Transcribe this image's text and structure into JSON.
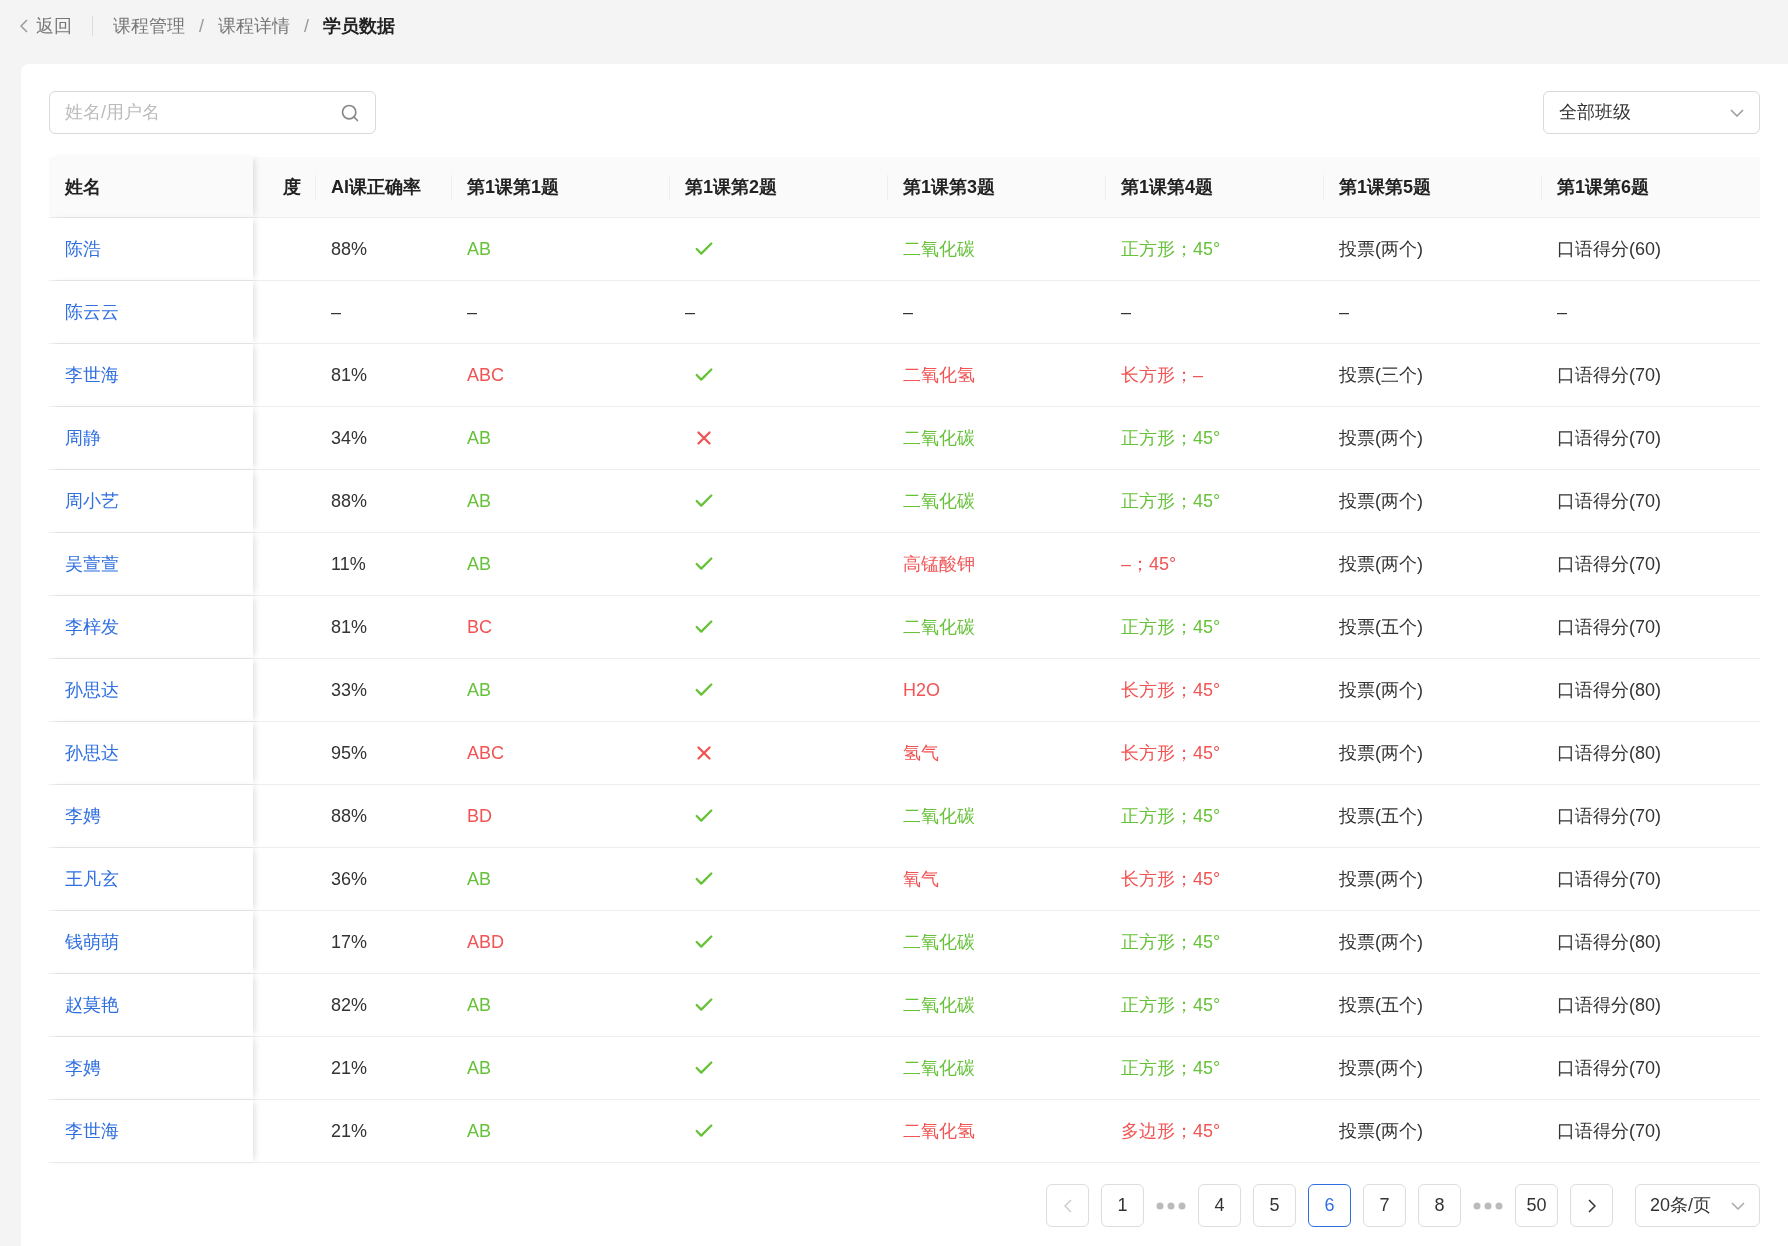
{
  "breadcrumb": {
    "back": "返回",
    "items": [
      {
        "kind": "link",
        "label": "课程管理",
        "current": false
      },
      {
        "kind": "separator",
        "label": "/"
      },
      {
        "kind": "link",
        "label": "课程详情",
        "current": false
      },
      {
        "kind": "separator",
        "label": "/"
      },
      {
        "kind": "link",
        "label": "学员数据",
        "current": true
      }
    ]
  },
  "search": {
    "placeholder": "姓名/用户名"
  },
  "class_filter": {
    "value": "全部班级"
  },
  "table": {
    "columns": [
      "姓名",
      "度",
      "AI课正确率",
      "第1课第1题",
      "第1课第2题",
      "第1课第3题",
      "第1课第4题",
      "第1课第5题",
      "第1课第6题"
    ],
    "rows": [
      {
        "cells": [
          {
            "kind": "link",
            "text": "陈浩"
          },
          {
            "kind": "plain",
            "text": ""
          },
          {
            "kind": "plain",
            "text": "88%"
          },
          {
            "kind": "answer",
            "text": "AB",
            "graded": true,
            "correct": true
          },
          {
            "kind": "icon",
            "graded": true,
            "correct": true
          },
          {
            "kind": "answer",
            "text": "二氧化碳",
            "graded": true,
            "correct": true
          },
          {
            "kind": "answer",
            "text": "正方形；45°",
            "graded": true,
            "correct": true
          },
          {
            "kind": "answer",
            "text": "投票(两个)",
            "graded": false
          },
          {
            "kind": "answer",
            "text": "口语得分(60)",
            "graded": false
          }
        ]
      },
      {
        "cells": [
          {
            "kind": "link",
            "text": "陈云云"
          },
          {
            "kind": "plain",
            "text": ""
          },
          {
            "kind": "plain",
            "text": "–"
          },
          {
            "kind": "answer",
            "text": "–",
            "graded": false
          },
          {
            "kind": "answer",
            "text": "–",
            "graded": false
          },
          {
            "kind": "answer",
            "text": "–",
            "graded": false
          },
          {
            "kind": "answer",
            "text": "–",
            "graded": false
          },
          {
            "kind": "answer",
            "text": "–",
            "graded": false
          },
          {
            "kind": "answer",
            "text": "–",
            "graded": false
          }
        ]
      },
      {
        "cells": [
          {
            "kind": "link",
            "text": "李世海"
          },
          {
            "kind": "plain",
            "text": ""
          },
          {
            "kind": "plain",
            "text": "81%"
          },
          {
            "kind": "answer",
            "text": "ABC",
            "graded": true,
            "correct": false
          },
          {
            "kind": "icon",
            "graded": true,
            "correct": true
          },
          {
            "kind": "answer",
            "text": "二氧化氢",
            "graded": true,
            "correct": false
          },
          {
            "kind": "answer",
            "text": "长方形；–",
            "graded": true,
            "correct": false
          },
          {
            "kind": "answer",
            "text": "投票(三个)",
            "graded": false
          },
          {
            "kind": "answer",
            "text": "口语得分(70)",
            "graded": false
          }
        ]
      },
      {
        "cells": [
          {
            "kind": "link",
            "text": "周静"
          },
          {
            "kind": "plain",
            "text": ""
          },
          {
            "kind": "plain",
            "text": "34%"
          },
          {
            "kind": "answer",
            "text": "AB",
            "graded": true,
            "correct": true
          },
          {
            "kind": "icon",
            "graded": true,
            "correct": false
          },
          {
            "kind": "answer",
            "text": "二氧化碳",
            "graded": true,
            "correct": true
          },
          {
            "kind": "answer",
            "text": "正方形；45°",
            "graded": true,
            "correct": true
          },
          {
            "kind": "answer",
            "text": "投票(两个)",
            "graded": false
          },
          {
            "kind": "answer",
            "text": "口语得分(70)",
            "graded": false
          }
        ]
      },
      {
        "cells": [
          {
            "kind": "link",
            "text": "周小艺"
          },
          {
            "kind": "plain",
            "text": ""
          },
          {
            "kind": "plain",
            "text": "88%"
          },
          {
            "kind": "answer",
            "text": "AB",
            "graded": true,
            "correct": true
          },
          {
            "kind": "icon",
            "graded": true,
            "correct": true
          },
          {
            "kind": "answer",
            "text": "二氧化碳",
            "graded": true,
            "correct": true
          },
          {
            "kind": "answer",
            "text": "正方形；45°",
            "graded": true,
            "correct": true
          },
          {
            "kind": "answer",
            "text": "投票(两个)",
            "graded": false
          },
          {
            "kind": "answer",
            "text": "口语得分(70)",
            "graded": false
          }
        ]
      },
      {
        "cells": [
          {
            "kind": "link",
            "text": "吴萱萱"
          },
          {
            "kind": "plain",
            "text": ""
          },
          {
            "kind": "plain",
            "text": "11%"
          },
          {
            "kind": "answer",
            "text": "AB",
            "graded": true,
            "correct": true
          },
          {
            "kind": "icon",
            "graded": true,
            "correct": true
          },
          {
            "kind": "answer",
            "text": "高锰酸钾",
            "graded": true,
            "correct": false
          },
          {
            "kind": "answer",
            "text": "–；45°",
            "graded": true,
            "correct": false
          },
          {
            "kind": "answer",
            "text": "投票(两个)",
            "graded": false
          },
          {
            "kind": "answer",
            "text": "口语得分(70)",
            "graded": false
          }
        ]
      },
      {
        "cells": [
          {
            "kind": "link",
            "text": "李梓发"
          },
          {
            "kind": "plain",
            "text": ""
          },
          {
            "kind": "plain",
            "text": "81%"
          },
          {
            "kind": "answer",
            "text": "BC",
            "graded": true,
            "correct": false
          },
          {
            "kind": "icon",
            "graded": true,
            "correct": true
          },
          {
            "kind": "answer",
            "text": "二氧化碳",
            "graded": true,
            "correct": true
          },
          {
            "kind": "answer",
            "text": "正方形；45°",
            "graded": true,
            "correct": true
          },
          {
            "kind": "answer",
            "text": "投票(五个)",
            "graded": false
          },
          {
            "kind": "answer",
            "text": "口语得分(70)",
            "graded": false
          }
        ]
      },
      {
        "cells": [
          {
            "kind": "link",
            "text": "孙思达"
          },
          {
            "kind": "plain",
            "text": ""
          },
          {
            "kind": "plain",
            "text": "33%"
          },
          {
            "kind": "answer",
            "text": "AB",
            "graded": true,
            "correct": true
          },
          {
            "kind": "icon",
            "graded": true,
            "correct": true
          },
          {
            "kind": "answer",
            "text": "H2O",
            "graded": true,
            "correct": false
          },
          {
            "kind": "answer",
            "text": "长方形；45°",
            "graded": true,
            "correct": false
          },
          {
            "kind": "answer",
            "text": "投票(两个)",
            "graded": false
          },
          {
            "kind": "answer",
            "text": "口语得分(80)",
            "graded": false
          }
        ]
      },
      {
        "cells": [
          {
            "kind": "link",
            "text": "孙思达"
          },
          {
            "kind": "plain",
            "text": ""
          },
          {
            "kind": "plain",
            "text": "95%"
          },
          {
            "kind": "answer",
            "text": "ABC",
            "graded": true,
            "correct": false
          },
          {
            "kind": "icon",
            "graded": true,
            "correct": false
          },
          {
            "kind": "answer",
            "text": "氢气",
            "graded": true,
            "correct": false
          },
          {
            "kind": "answer",
            "text": "长方形；45°",
            "graded": true,
            "correct": false
          },
          {
            "kind": "answer",
            "text": "投票(两个)",
            "graded": false
          },
          {
            "kind": "answer",
            "text": "口语得分(80)",
            "graded": false
          }
        ]
      },
      {
        "cells": [
          {
            "kind": "link",
            "text": "李娉"
          },
          {
            "kind": "plain",
            "text": ""
          },
          {
            "kind": "plain",
            "text": "88%"
          },
          {
            "kind": "answer",
            "text": "BD",
            "graded": true,
            "correct": false
          },
          {
            "kind": "icon",
            "graded": true,
            "correct": true
          },
          {
            "kind": "answer",
            "text": "二氧化碳",
            "graded": true,
            "correct": true
          },
          {
            "kind": "answer",
            "text": "正方形；45°",
            "graded": true,
            "correct": true
          },
          {
            "kind": "answer",
            "text": "投票(五个)",
            "graded": false
          },
          {
            "kind": "answer",
            "text": "口语得分(70)",
            "graded": false
          }
        ]
      },
      {
        "cells": [
          {
            "kind": "link",
            "text": "王凡玄"
          },
          {
            "kind": "plain",
            "text": ""
          },
          {
            "kind": "plain",
            "text": "36%"
          },
          {
            "kind": "answer",
            "text": "AB",
            "graded": true,
            "correct": true
          },
          {
            "kind": "icon",
            "graded": true,
            "correct": true
          },
          {
            "kind": "answer",
            "text": "氧气",
            "graded": true,
            "correct": false
          },
          {
            "kind": "answer",
            "text": "长方形；45°",
            "graded": true,
            "correct": false
          },
          {
            "kind": "answer",
            "text": "投票(两个)",
            "graded": false
          },
          {
            "kind": "answer",
            "text": "口语得分(70)",
            "graded": false
          }
        ]
      },
      {
        "cells": [
          {
            "kind": "link",
            "text": "钱萌萌"
          },
          {
            "kind": "plain",
            "text": ""
          },
          {
            "kind": "plain",
            "text": "17%"
          },
          {
            "kind": "answer",
            "text": "ABD",
            "graded": true,
            "correct": false
          },
          {
            "kind": "icon",
            "graded": true,
            "correct": true
          },
          {
            "kind": "answer",
            "text": "二氧化碳",
            "graded": true,
            "correct": true
          },
          {
            "kind": "answer",
            "text": "正方形；45°",
            "graded": true,
            "correct": true
          },
          {
            "kind": "answer",
            "text": "投票(两个)",
            "graded": false
          },
          {
            "kind": "answer",
            "text": "口语得分(80)",
            "graded": false
          }
        ]
      },
      {
        "cells": [
          {
            "kind": "link",
            "text": "赵莫艳"
          },
          {
            "kind": "plain",
            "text": ""
          },
          {
            "kind": "plain",
            "text": "82%"
          },
          {
            "kind": "answer",
            "text": "AB",
            "graded": true,
            "correct": true
          },
          {
            "kind": "icon",
            "graded": true,
            "correct": true
          },
          {
            "kind": "answer",
            "text": "二氧化碳",
            "graded": true,
            "correct": true
          },
          {
            "kind": "answer",
            "text": "正方形；45°",
            "graded": true,
            "correct": true
          },
          {
            "kind": "answer",
            "text": "投票(五个)",
            "graded": false
          },
          {
            "kind": "answer",
            "text": "口语得分(80)",
            "graded": false
          }
        ]
      },
      {
        "cells": [
          {
            "kind": "link",
            "text": "李娉"
          },
          {
            "kind": "plain",
            "text": ""
          },
          {
            "kind": "plain",
            "text": "21%"
          },
          {
            "kind": "answer",
            "text": "AB",
            "graded": true,
            "correct": true
          },
          {
            "kind": "icon",
            "graded": true,
            "correct": true
          },
          {
            "kind": "answer",
            "text": "二氧化碳",
            "graded": true,
            "correct": true
          },
          {
            "kind": "answer",
            "text": "正方形；45°",
            "graded": true,
            "correct": true
          },
          {
            "kind": "answer",
            "text": "投票(两个)",
            "graded": false
          },
          {
            "kind": "answer",
            "text": "口语得分(70)",
            "graded": false
          }
        ]
      },
      {
        "cells": [
          {
            "kind": "link",
            "text": "李世海"
          },
          {
            "kind": "plain",
            "text": ""
          },
          {
            "kind": "plain",
            "text": "21%"
          },
          {
            "kind": "answer",
            "text": "AB",
            "graded": true,
            "correct": true
          },
          {
            "kind": "icon",
            "graded": true,
            "correct": true
          },
          {
            "kind": "answer",
            "text": "二氧化氢",
            "graded": true,
            "correct": false
          },
          {
            "kind": "answer",
            "text": "多边形；45°",
            "graded": true,
            "correct": false
          },
          {
            "kind": "answer",
            "text": "投票(两个)",
            "graded": false
          },
          {
            "kind": "answer",
            "text": "口语得分(70)",
            "graded": false
          }
        ]
      }
    ]
  },
  "pagination": {
    "prev_disabled": true,
    "next_disabled": false,
    "page_size": "20条/页",
    "pages": [
      {
        "kind": "page",
        "label": "1",
        "selected": false
      },
      {
        "kind": "ellipsis"
      },
      {
        "kind": "page",
        "label": "4",
        "selected": false
      },
      {
        "kind": "page",
        "label": "5",
        "selected": false
      },
      {
        "kind": "page",
        "label": "6",
        "selected": true
      },
      {
        "kind": "page",
        "label": "7",
        "selected": false
      },
      {
        "kind": "page",
        "label": "8",
        "selected": false
      },
      {
        "kind": "ellipsis"
      },
      {
        "kind": "page",
        "label": "50",
        "selected": false
      }
    ]
  }
}
